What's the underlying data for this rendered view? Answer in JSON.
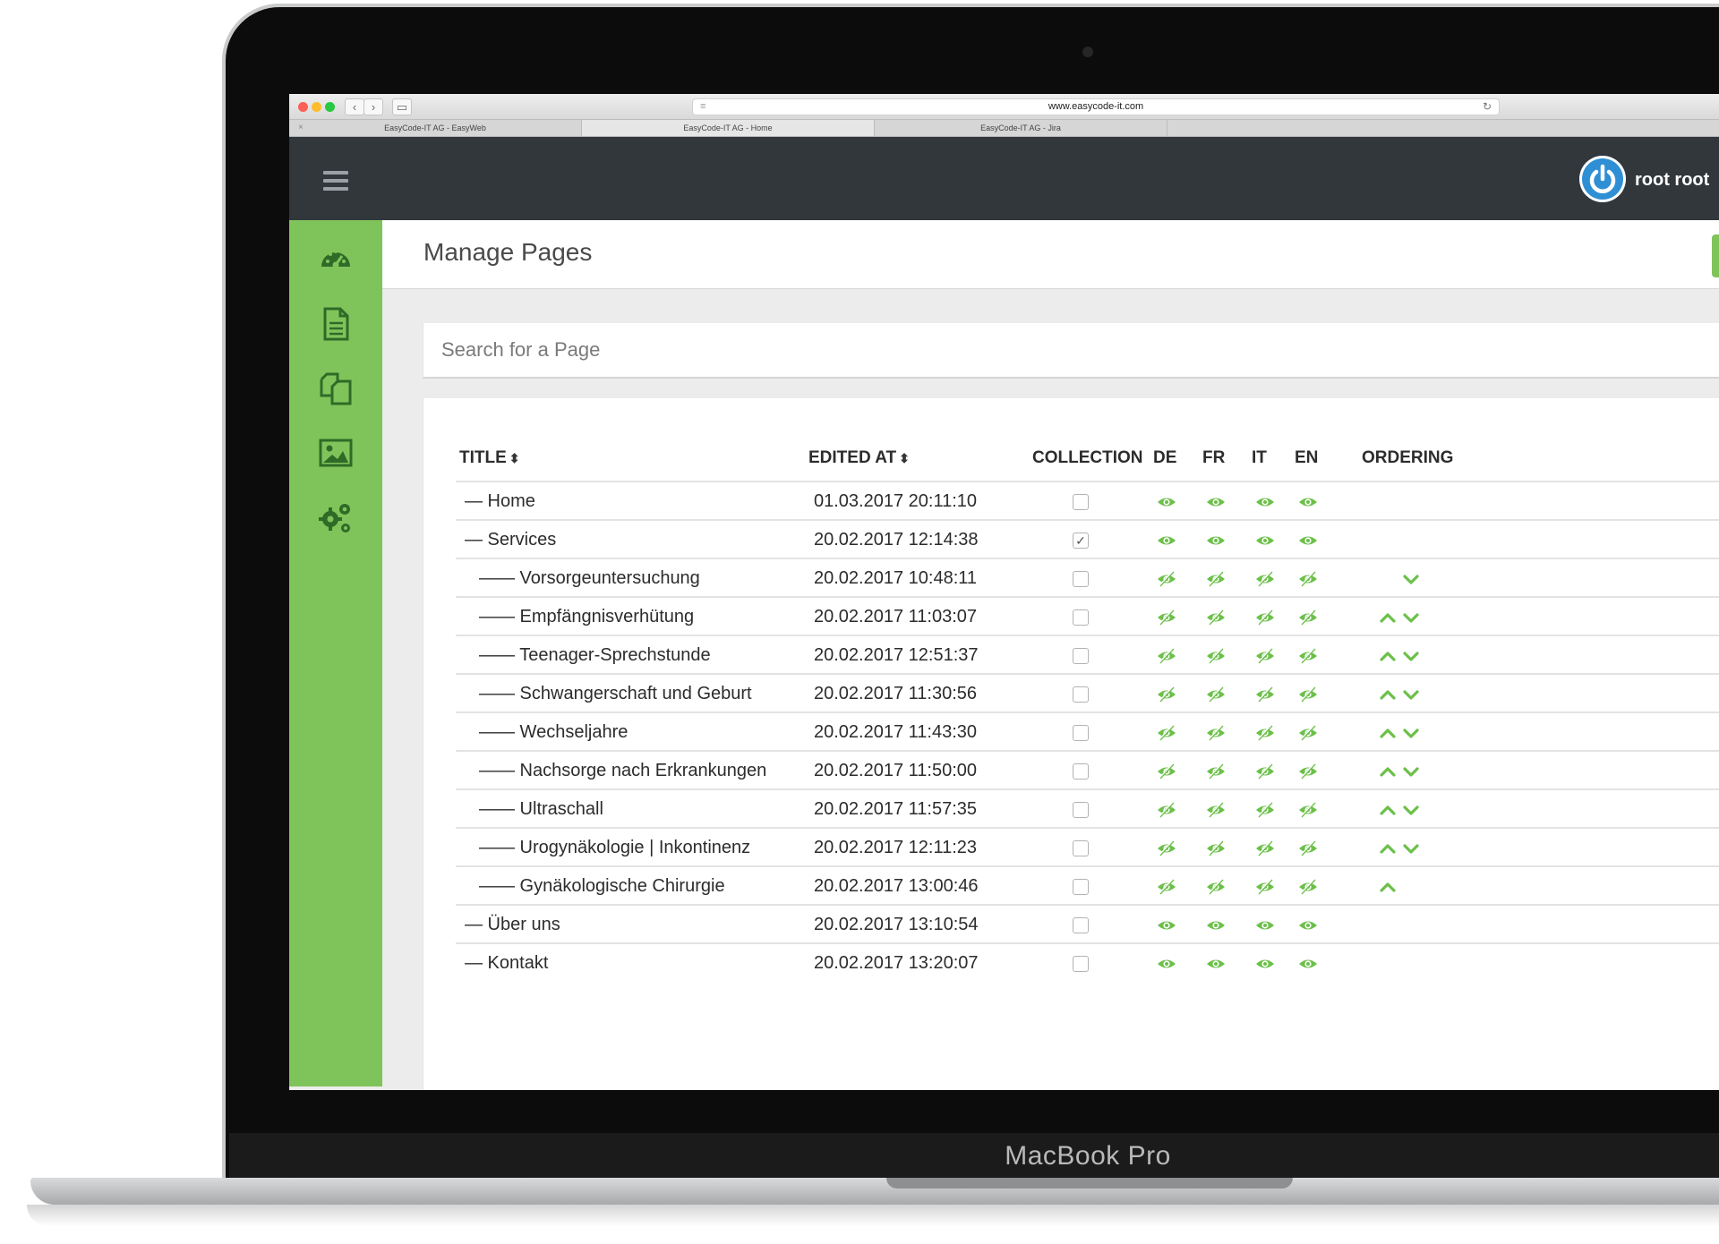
{
  "device": {
    "model": "MacBook Pro"
  },
  "browser": {
    "url": "www.easycode-it.com",
    "tabs": [
      {
        "label": "EasyCode-IT AG - EasyWeb",
        "active": false
      },
      {
        "label": "EasyCode-IT AG - Home",
        "active": true
      },
      {
        "label": "EasyCode-IT AG - Jira",
        "active": false
      }
    ]
  },
  "header": {
    "user_name": "root root",
    "menu_icon": "hamburger-icon",
    "logo_icon": "power-icon"
  },
  "sidebar": {
    "items": [
      {
        "icon": "dashboard-icon"
      },
      {
        "icon": "document-icon"
      },
      {
        "icon": "copy-icon"
      },
      {
        "icon": "image-icon"
      },
      {
        "icon": "gears-icon"
      }
    ]
  },
  "page": {
    "title": "Manage Pages"
  },
  "search": {
    "placeholder": "Search for a Page"
  },
  "table": {
    "columns": {
      "title": "TITLE",
      "edited_at": "EDITED AT",
      "collection": "COLLECTION",
      "de": "DE",
      "fr": "FR",
      "it": "IT",
      "en": "EN",
      "ordering": "ORDERING"
    },
    "rows": [
      {
        "title": "— Home",
        "edited_at": "01.03.2017 20:11:10",
        "collection": false,
        "visible": true,
        "up": false,
        "down": false
      },
      {
        "title": "— Services",
        "edited_at": "20.02.2017 12:14:38",
        "collection": true,
        "visible": true,
        "up": false,
        "down": false
      },
      {
        "title": "—— Vorsorgeuntersuchung",
        "edited_at": "20.02.2017 10:48:11",
        "collection": false,
        "visible": false,
        "up": false,
        "down": true
      },
      {
        "title": "—— Empfängnisverhütung",
        "edited_at": "20.02.2017 11:03:07",
        "collection": false,
        "visible": false,
        "up": true,
        "down": true
      },
      {
        "title": "—— Teenager-Sprechstunde",
        "edited_at": "20.02.2017 12:51:37",
        "collection": false,
        "visible": false,
        "up": true,
        "down": true
      },
      {
        "title": "—— Schwangerschaft und Geburt",
        "edited_at": "20.02.2017 11:30:56",
        "collection": false,
        "visible": false,
        "up": true,
        "down": true
      },
      {
        "title": "—— Wechseljahre",
        "edited_at": "20.02.2017 11:43:30",
        "collection": false,
        "visible": false,
        "up": true,
        "down": true
      },
      {
        "title": "—— Nachsorge nach Erkrankungen",
        "edited_at": "20.02.2017 11:50:00",
        "collection": false,
        "visible": false,
        "up": true,
        "down": true
      },
      {
        "title": "—— Ultraschall",
        "edited_at": "20.02.2017 11:57:35",
        "collection": false,
        "visible": false,
        "up": true,
        "down": true
      },
      {
        "title": "—— Urogynäkologie | Inkontinenz",
        "edited_at": "20.02.2017 12:11:23",
        "collection": false,
        "visible": false,
        "up": true,
        "down": true
      },
      {
        "title": "—— Gynäkologische Chirurgie",
        "edited_at": "20.02.2017 13:00:46",
        "collection": false,
        "visible": false,
        "up": true,
        "down": false
      },
      {
        "title": "— Über uns",
        "edited_at": "20.02.2017 13:10:54",
        "collection": false,
        "visible": true,
        "up": false,
        "down": false
      },
      {
        "title": "— Kontakt",
        "edited_at": "20.02.2017 13:20:07",
        "collection": false,
        "visible": true,
        "up": false,
        "down": false
      }
    ]
  },
  "colors": {
    "accent_green": "#7fc45a",
    "icon_green": "#6cc04a",
    "header_dark": "#32373c",
    "power_blue": "#2e8fd4"
  }
}
